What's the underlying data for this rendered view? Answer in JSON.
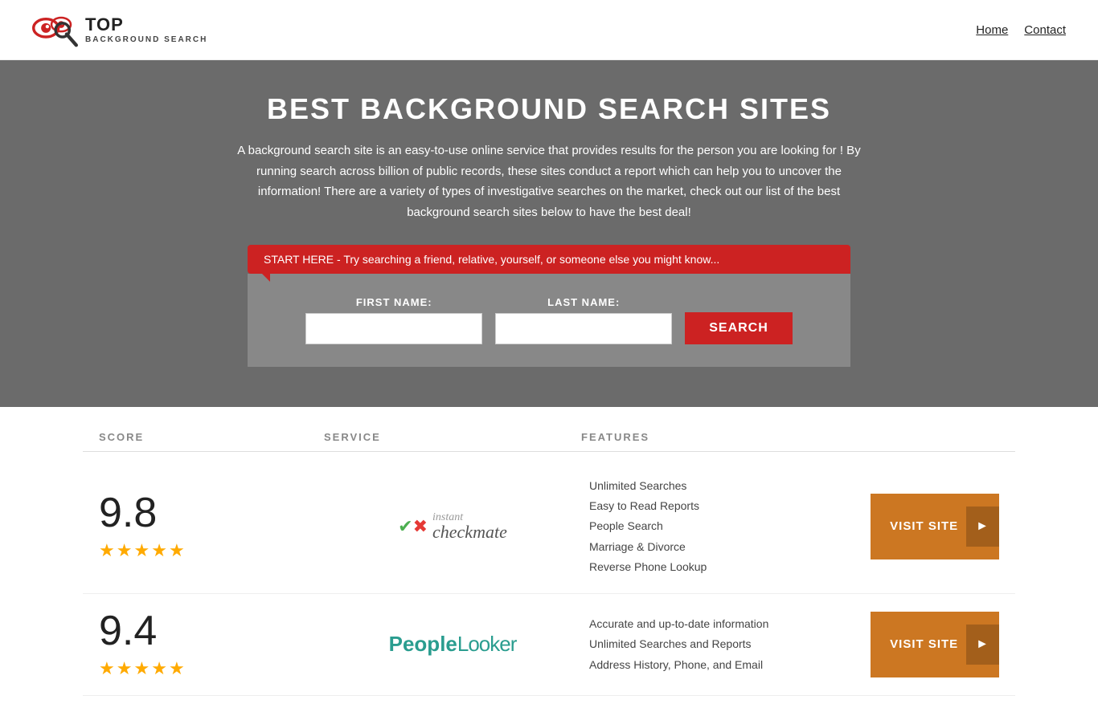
{
  "header": {
    "logo_top": "TOP",
    "logo_bottom": "BACKGROUND SEARCH",
    "nav": [
      {
        "label": "Home",
        "href": "#"
      },
      {
        "label": "Contact",
        "href": "#"
      }
    ]
  },
  "hero": {
    "title": "BEST BACKGROUND SEARCH SITES",
    "description": "A background search site is an easy-to-use online service that provides results  for the person you are looking for ! By  running  search across billion of public records, these sites conduct  a report which can help you to uncover the information! There are a variety of types of investigative searches on the market, check out our  list of the best background search sites below to have the best deal!",
    "callout": "START HERE - Try searching a friend, relative, yourself, or someone else you might know...",
    "first_name_label": "FIRST NAME:",
    "last_name_label": "LAST NAME:",
    "search_button": "SEARCH"
  },
  "table": {
    "columns": {
      "score": "SCORE",
      "service": "SERVICE",
      "features": "FEATURES",
      "action": ""
    },
    "rows": [
      {
        "score": "9.8",
        "stars": 4.5,
        "star_count": 5,
        "service_name": "Instant Checkmate",
        "features": [
          "Unlimited Searches",
          "Easy to Read Reports",
          "People Search",
          "Marriage & Divorce",
          "Reverse Phone Lookup"
        ],
        "visit_label": "VISIT SITE"
      },
      {
        "score": "9.4",
        "stars": 4.5,
        "star_count": 5,
        "service_name": "PeopleLooker",
        "features": [
          "Accurate and up-to-date information",
          "Unlimited Searches and Reports",
          "Address History, Phone, and Email"
        ],
        "visit_label": "VISIT SITE"
      }
    ]
  }
}
